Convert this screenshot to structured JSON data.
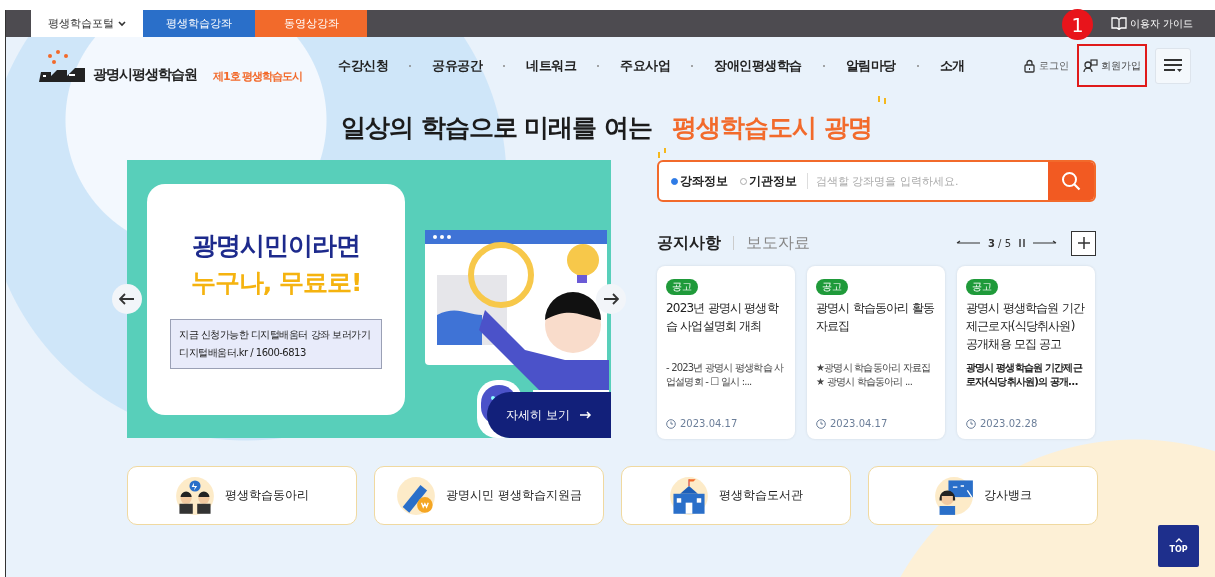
{
  "top_bar": {
    "tabs": [
      {
        "label": "평생학습포털",
        "selected": true
      },
      {
        "label": "평생학습강좌",
        "selected": false,
        "color": "#2a6fc9"
      },
      {
        "label": "동영상강좌",
        "selected": false,
        "color": "#f26a2b"
      }
    ],
    "guide_link": "이용자 가이드"
  },
  "header": {
    "logo_name": "광명시평생학습원",
    "logo_slogan": "제1호 평생학습도시",
    "nav": [
      "수강신청",
      "공유공간",
      "네트워크",
      "주요사업",
      "장애인평생학습",
      "알림마당",
      "소개"
    ],
    "login": "로그인",
    "signup": "회원가입",
    "annotation": "1"
  },
  "headline": {
    "text": "일상의 학습으로 미래를 여는",
    "highlight": "평생학습도시 광명"
  },
  "banner": {
    "title": "광명시민이라면",
    "subtitle": "누구나, 무료로!",
    "info_line_1": "지금 신청가능한 디지털배움터 강좌 보러가기",
    "info_line_2": "디지털배움터.kr / 1600-6813",
    "button": "자세히 보기"
  },
  "search": {
    "options": [
      {
        "label": "강좌정보",
        "selected": true
      },
      {
        "label": "기관정보",
        "selected": false
      }
    ],
    "placeholder": "검색할 강좌명을 입력하세요."
  },
  "notices": {
    "tabs": [
      {
        "label": "공지사항",
        "selected": true
      },
      {
        "label": "보도자료",
        "selected": false
      }
    ],
    "pager": "**3** / 5",
    "cards": [
      {
        "badge": "공고",
        "title": "2023년 광명시 평생학습 사업설명회 개최",
        "summary": " - 2023년 광명시 평생학습 사업설명회 - ☐ 일시 :...",
        "date": "2023.04.17"
      },
      {
        "badge": "공고",
        "title": "광명시 학습동아리 활동 자료집",
        "summary": "★광명시 학습동아리 자료집★ 광명시 학습동아리 ...",
        "date": "2023.04.17"
      },
      {
        "badge": "공고",
        "title": "광명시 평생학습원 기간제근로자(식당취사원) 공개채용 모집 공고",
        "summary": "광명시 평생학습원 기간제근로자(식당취사원)의 공개…",
        "date": "2023.02.28"
      }
    ]
  },
  "quick_links": [
    "평생학습동아리",
    "광명시민 평생학습지원금",
    "평생학습도서관",
    "강사뱅크"
  ],
  "top_button": "TOP"
}
